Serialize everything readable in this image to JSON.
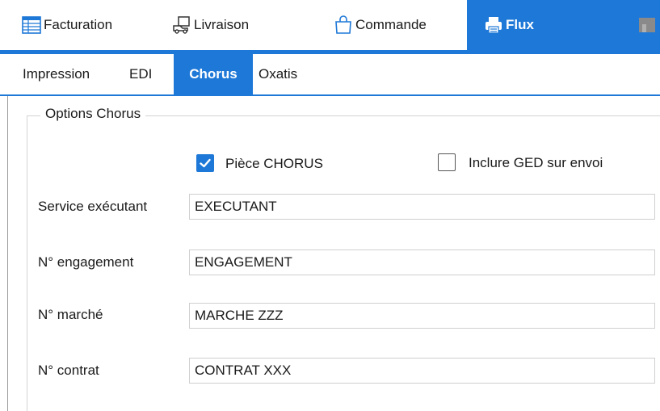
{
  "top_tabs": [
    {
      "label": "Facturation",
      "icon": "invoice-table-icon",
      "active": false
    },
    {
      "label": "Livraison",
      "icon": "delivery-box-icon",
      "active": false
    },
    {
      "label": "Commande",
      "icon": "shopping-bag-icon",
      "active": false
    },
    {
      "label": "Flux",
      "icon": "printer-icon",
      "active": true
    }
  ],
  "sub_tabs": [
    {
      "label": "Impression",
      "active": false
    },
    {
      "label": "EDI",
      "active": false
    },
    {
      "label": "Chorus",
      "active": true
    },
    {
      "label": "Oxatis",
      "active": false
    }
  ],
  "options": {
    "legend": "Options Chorus",
    "piece_chorus": {
      "label": "Pièce CHORUS",
      "checked": true
    },
    "inclure_ged": {
      "label": "Inclure GED sur envoi",
      "checked": false
    }
  },
  "fields": {
    "service_executant": {
      "label": "Service exécutant",
      "value": "EXECUTANT"
    },
    "engagement": {
      "label": "N° engagement",
      "value": "ENGAGEMENT"
    },
    "marche": {
      "label": "N° marché",
      "value": "MARCHE ZZZ"
    },
    "contrat": {
      "label": "N° contrat",
      "value": "CONTRAT XXX"
    }
  },
  "colors": {
    "accent": "#1e78d7",
    "border": "#d3d3d3",
    "text": "#1a1a1a"
  }
}
